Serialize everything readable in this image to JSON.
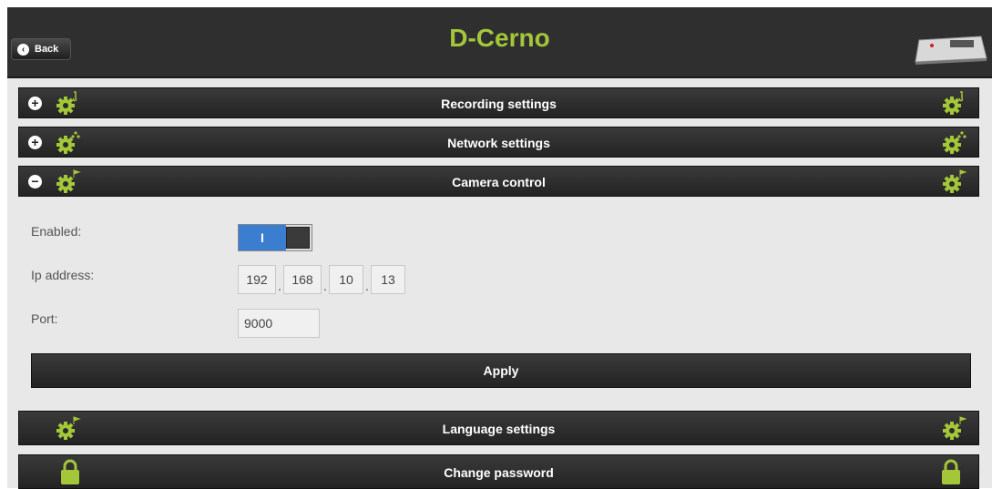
{
  "header": {
    "title": "D-Cerno",
    "back_label": "Back",
    "device_image": "d-cerno-device-image"
  },
  "sections": {
    "recording": {
      "label": "Recording settings",
      "state": "collapsed",
      "icon": "gear-music-icon"
    },
    "network": {
      "label": "Network settings",
      "state": "collapsed",
      "icon": "gear-network-icon"
    },
    "camera": {
      "label": "Camera control",
      "state": "expanded",
      "icon": "gear-flag-icon"
    },
    "language": {
      "label": "Language settings",
      "icon": "gear-flag-icon"
    },
    "password": {
      "label": "Change password",
      "icon": "lock-icon"
    }
  },
  "camera_control": {
    "enabled_label": "Enabled:",
    "enabled_value": "I",
    "ip_label": "Ip address:",
    "ip": [
      "192",
      "168",
      "10",
      "13"
    ],
    "ip_separator": ".",
    "port_label": "Port:",
    "port_value": "9000",
    "apply_label": "Apply"
  },
  "colors": {
    "accent": "#a4c639",
    "toggle_on": "#3b7dcf",
    "bar": "#2f2f2f",
    "content_bg": "#e8e8e8"
  }
}
